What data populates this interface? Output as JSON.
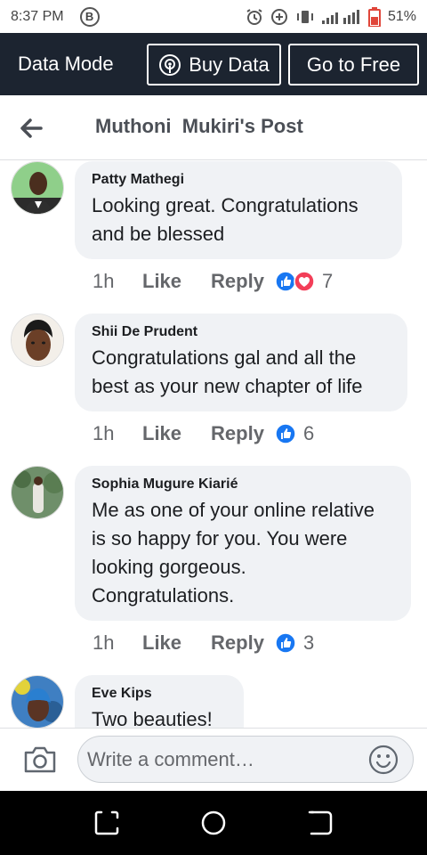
{
  "status_bar": {
    "time": "8:37 PM",
    "b_icon": "B",
    "icons": [
      "alarm-icon",
      "data-saver-icon",
      "vibrate-icon",
      "signal-icon",
      "battery-icon"
    ],
    "battery": "51%"
  },
  "data_bar": {
    "mode_label": "Data Mode",
    "buy_label": "Buy Data",
    "free_label": "Go to Free"
  },
  "header": {
    "title": "Muthoni  Mukiri's Post"
  },
  "comments": [
    {
      "author": "Patty Mathegi",
      "text": "Looking great. Congratulations and be blessed",
      "time": "1h",
      "like": "Like",
      "reply": "Reply",
      "reactions": [
        "like",
        "love"
      ],
      "count": "7"
    },
    {
      "author": "Shii De Prudent",
      "text": "Congratulations gal and all the best as your new chapter of life",
      "time": "1h",
      "like": "Like",
      "reply": "Reply",
      "reactions": [
        "like"
      ],
      "count": "6"
    },
    {
      "author": "Sophia Mugure Kiarié",
      "text": "Me as one of your online relative is so happy for you. You were looking gorgeous. Congratulations.",
      "time": "1h",
      "like": "Like",
      "reply": "Reply",
      "reactions": [
        "like"
      ],
      "count": "3"
    },
    {
      "author": "Eve Kips",
      "text": "Two beauties!"
    }
  ],
  "composer": {
    "placeholder": "Write a comment…"
  },
  "colors": {
    "data_bar_bg": "#1c2430",
    "bubble_bg": "#f0f2f5",
    "like_blue": "#1877f2",
    "love_red": "#f33e58",
    "battery_red": "#e0463a"
  }
}
